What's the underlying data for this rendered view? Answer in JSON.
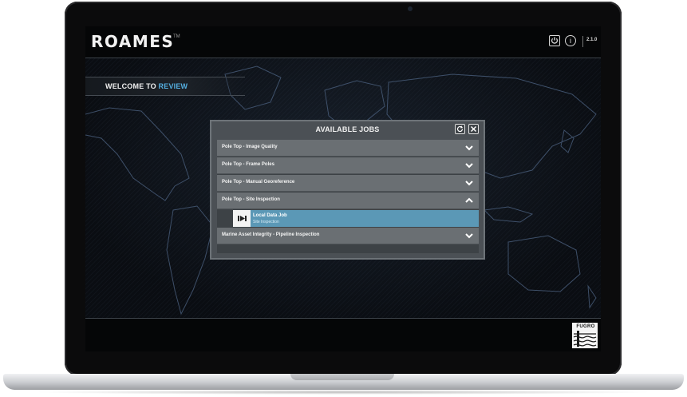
{
  "header": {
    "logo": "ROAMES",
    "trademark": "TM",
    "power_icon": "power-icon",
    "info_icon": "info-icon",
    "version": "2.1.0"
  },
  "welcome": {
    "prefix": "WELCOME TO",
    "accent": "REVIEW"
  },
  "modal": {
    "title": "AVAILABLE JOBS",
    "refresh_icon": "refresh-icon",
    "close_icon": "close-icon",
    "jobs": [
      {
        "label": "Pole Top - Image Quality",
        "expanded": false
      },
      {
        "label": "Pole Top - Frame Poles",
        "expanded": false
      },
      {
        "label": "Pole Top - Manual Georeference",
        "expanded": false
      },
      {
        "label": "Pole Top - Site Inspection",
        "expanded": true
      },
      {
        "label": "Marine Asset Integrity - Pipeline Inspection",
        "expanded": false
      }
    ],
    "sub_job": {
      "title": "Local Data Job",
      "subtitle": "Site Inspection",
      "icon": "play-icon"
    }
  },
  "footer": {
    "logo": "FUGRO"
  },
  "colors": {
    "accent": "#54aee0",
    "selected_row": "#5b98b6",
    "row": "#6a6f73"
  }
}
